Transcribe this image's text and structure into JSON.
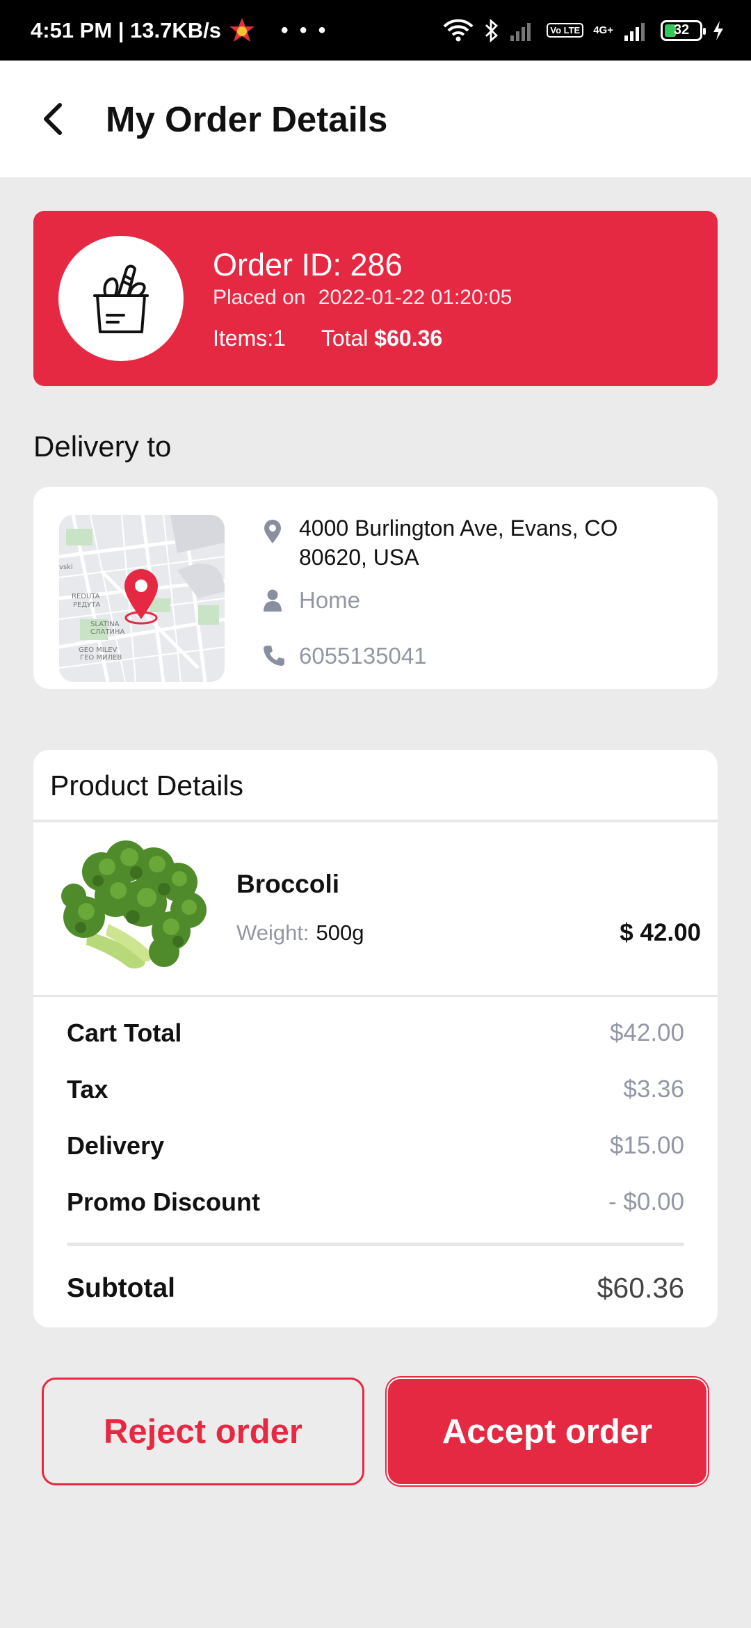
{
  "status_bar": {
    "time_speed": "4:51 PM | 13.7KB/s",
    "more": "• • •",
    "network": "4G+",
    "lte": "Vo LTE",
    "battery": "32"
  },
  "header": {
    "title": "My Order Details"
  },
  "order": {
    "id_text": "Order ID: 286",
    "placed_label": "Placed on",
    "placed_date": "2022-01-22 01:20:05",
    "items_text": "Items:1",
    "total_label": "Total",
    "total_value": "$60.36"
  },
  "delivery": {
    "section_label": "Delivery to",
    "address": "4000 Burlington Ave, Evans, CO 80620, USA",
    "address_type": "Home",
    "phone": "6055135041",
    "map_labels": [
      "REDUTA",
      "РЕДУТА",
      "SLATINA",
      "СЛАТИНА",
      "GEO MILEV",
      "ГЕО МИЛЕВ",
      "vski"
    ]
  },
  "product_details": {
    "title": "Product Details",
    "item": {
      "name": "Broccoli",
      "weight_label": "Weight:",
      "weight_value": "500g",
      "price": "$ 42.00"
    },
    "summary": [
      {
        "label": "Cart Total",
        "value": "$42.00"
      },
      {
        "label": "Tax",
        "value": "$3.36"
      },
      {
        "label": "Delivery",
        "value": "$15.00"
      },
      {
        "label": "Promo Discount",
        "value": "- $0.00"
      }
    ],
    "subtotal_label": "Subtotal",
    "subtotal_value": "$60.36"
  },
  "actions": {
    "reject_label": "Reject order",
    "accept_label": "Accept order"
  },
  "colors": {
    "accent": "#e52943",
    "background": "#ebebeb",
    "muted": "#9397a4",
    "icon": "#8a8fa0"
  }
}
